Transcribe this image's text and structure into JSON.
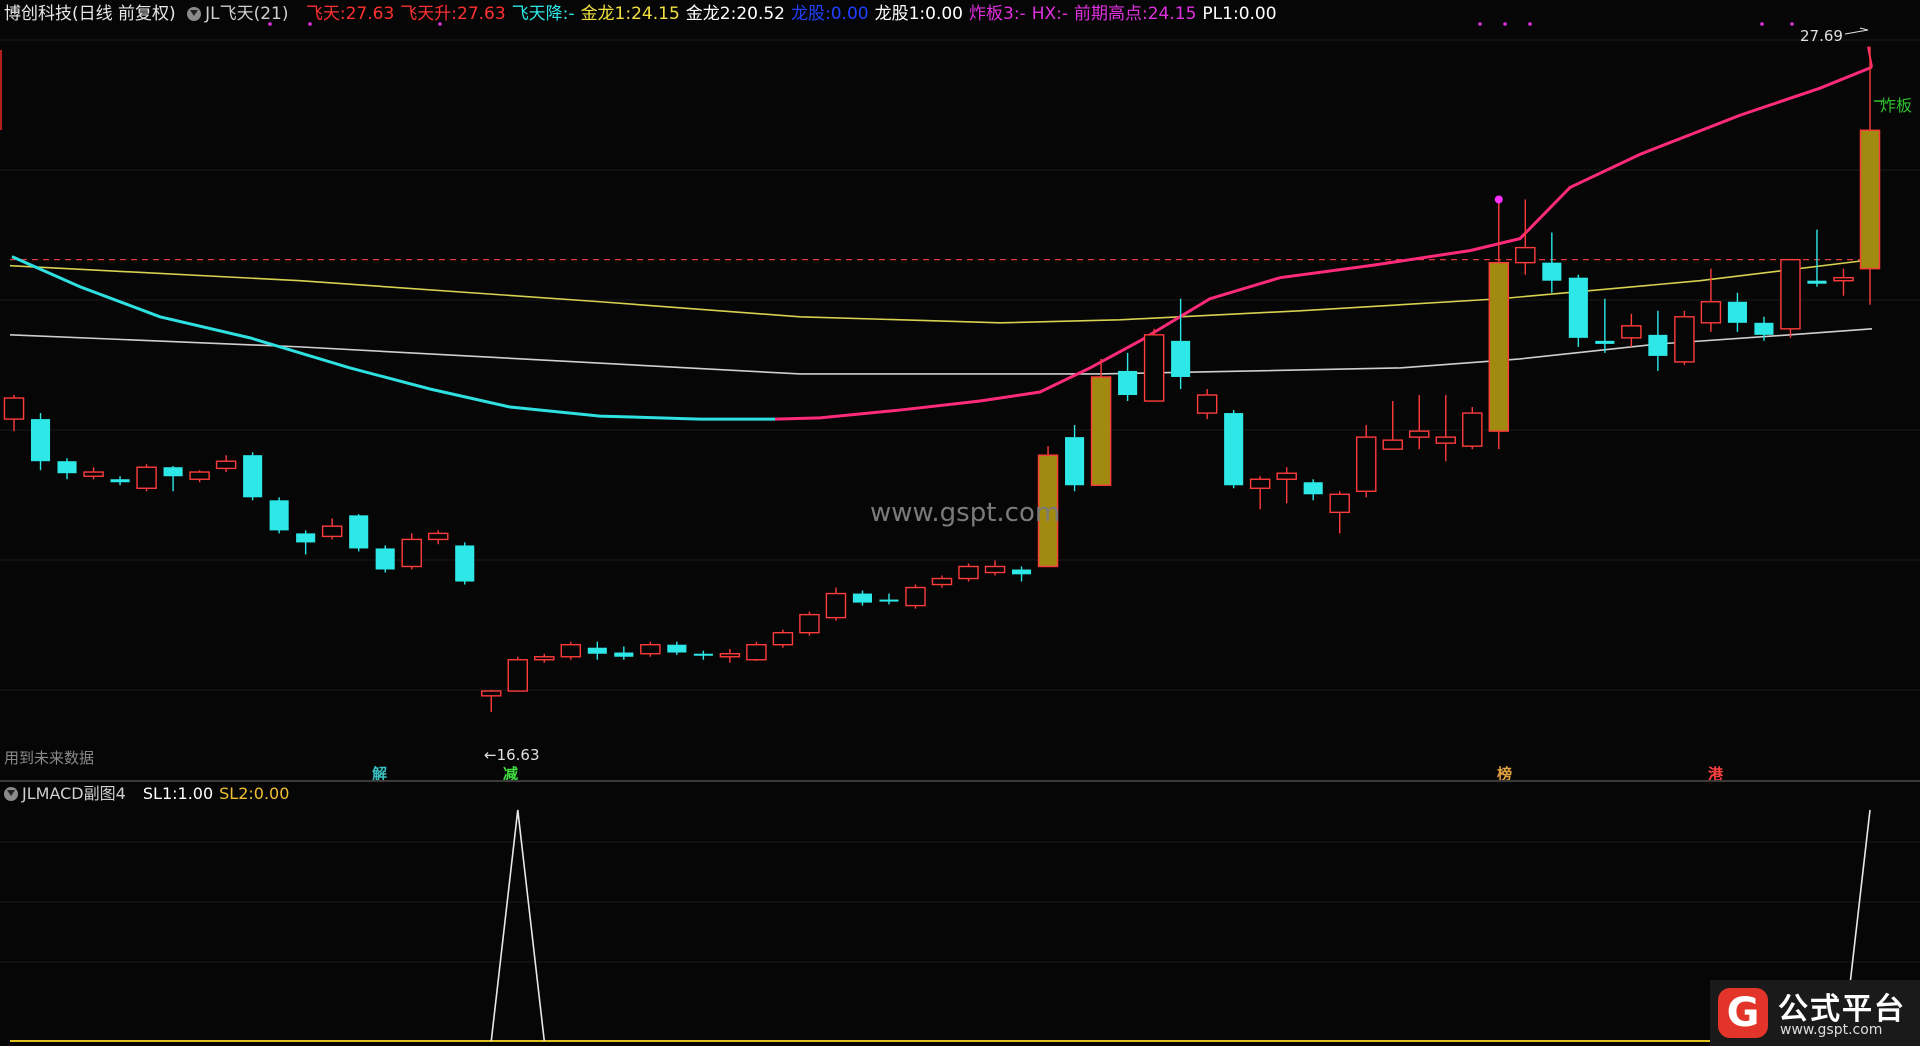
{
  "header": {
    "stock": "博创科技(日线 前复权)",
    "indicator": "JL飞天(21)",
    "items": [
      {
        "label": "飞天:",
        "value": "27.63",
        "color": "#ff3030"
      },
      {
        "label": "飞天升:",
        "value": "27.63",
        "color": "#ff3030"
      },
      {
        "label": "飞天降:",
        "value": "-",
        "color": "#2ee8e8"
      },
      {
        "label": "金龙1:",
        "value": "24.15",
        "color": "#f0e040"
      },
      {
        "label": "金龙2:",
        "value": "20.52",
        "color": "#ffffff"
      },
      {
        "label": "龙股:",
        "value": "0.00",
        "color": "#2040ff"
      },
      {
        "label": "龙股1:",
        "value": "0.00",
        "color": "#ffffff"
      },
      {
        "label": "炸板3:",
        "value": "-",
        "color": "#e030e0"
      },
      {
        "label": "HX:",
        "value": "-",
        "color": "#e030e0"
      },
      {
        "label": "前期高点:",
        "value": "24.15",
        "color": "#e030e0"
      },
      {
        "label": "PL1:",
        "value": "0.00",
        "color": "#ffffff"
      }
    ]
  },
  "main_chart": {
    "high_label": "27.69",
    "low_label": "16.63",
    "burst_label": "炸板",
    "future_data_note": "用到未来数据",
    "markers": [
      {
        "text": "解",
        "color": "#3ac0c0"
      },
      {
        "text": "减",
        "color": "#40e040"
      },
      {
        "text": "榜",
        "color": "#e0a040"
      },
      {
        "text": "港",
        "color": "#ff4040"
      }
    ],
    "watermark": "www.gspt.com",
    "colors": {
      "up": "#ff3b3b",
      "down": "#2ee8e8",
      "limit": "#a08a10",
      "pink": "#ff2a7a",
      "cyan": "#2ee0e0",
      "yellow": "#d8d050",
      "white": "#cfcfcf"
    }
  },
  "chart_data": {
    "type": "candlestick",
    "ylim": [
      16,
      28
    ],
    "candles": [
      [
        21.5,
        21.85,
        21.9,
        21.3
      ],
      [
        21.5,
        20.8,
        21.6,
        20.65
      ],
      [
        20.8,
        20.6,
        20.85,
        20.5
      ],
      [
        20.55,
        20.62,
        20.7,
        20.5
      ],
      [
        20.5,
        20.45,
        20.55,
        20.4
      ],
      [
        20.35,
        20.7,
        20.75,
        20.3
      ],
      [
        20.7,
        20.55,
        20.72,
        20.3
      ],
      [
        20.5,
        20.62,
        20.65,
        20.45
      ],
      [
        20.68,
        20.8,
        20.9,
        20.62
      ],
      [
        20.9,
        20.2,
        20.95,
        20.15
      ],
      [
        20.15,
        19.65,
        20.2,
        19.6
      ],
      [
        19.6,
        19.45,
        19.65,
        19.25
      ],
      [
        19.55,
        19.72,
        19.85,
        19.5
      ],
      [
        19.9,
        19.35,
        19.92,
        19.3
      ],
      [
        19.35,
        19.0,
        19.4,
        18.95
      ],
      [
        19.05,
        19.5,
        19.6,
        19.0
      ],
      [
        19.5,
        19.6,
        19.65,
        19.42
      ],
      [
        19.4,
        18.8,
        19.45,
        18.75
      ],
      [
        16.9,
        16.98,
        17.0,
        16.63
      ],
      [
        16.98,
        17.5,
        17.55,
        16.98
      ],
      [
        17.5,
        17.55,
        17.6,
        17.45
      ],
      [
        17.55,
        17.75,
        17.8,
        17.5
      ],
      [
        17.7,
        17.6,
        17.8,
        17.5
      ],
      [
        17.62,
        17.55,
        17.72,
        17.5
      ],
      [
        17.6,
        17.75,
        17.8,
        17.55
      ],
      [
        17.75,
        17.62,
        17.8,
        17.58
      ],
      [
        17.6,
        17.58,
        17.65,
        17.5
      ],
      [
        17.55,
        17.6,
        17.68,
        17.45
      ],
      [
        17.5,
        17.75,
        17.8,
        17.48
      ],
      [
        17.75,
        17.95,
        18.0,
        17.7
      ],
      [
        17.95,
        18.25,
        18.3,
        17.9
      ],
      [
        18.2,
        18.6,
        18.7,
        18.15
      ],
      [
        18.6,
        18.45,
        18.65,
        18.4
      ],
      [
        18.5,
        18.48,
        18.6,
        18.42
      ],
      [
        18.4,
        18.7,
        18.75,
        18.35
      ],
      [
        18.75,
        18.85,
        18.9,
        18.7
      ],
      [
        18.85,
        19.05,
        19.1,
        18.8
      ],
      [
        18.95,
        19.05,
        19.15,
        18.9
      ],
      [
        19.0,
        18.92,
        19.05,
        18.8
      ],
      [
        19.05,
        20.9,
        21.05,
        19.05
      ],
      [
        21.2,
        20.4,
        21.4,
        20.3
      ],
      [
        20.4,
        22.2,
        22.5,
        20.4
      ],
      [
        22.3,
        21.9,
        22.6,
        21.8
      ],
      [
        21.8,
        22.9,
        23.0,
        21.8
      ],
      [
        22.8,
        22.2,
        23.5,
        22.0
      ],
      [
        21.6,
        21.9,
        22.0,
        21.5
      ],
      [
        21.6,
        20.4,
        21.65,
        20.35
      ],
      [
        20.35,
        20.5,
        20.55,
        20.0
      ],
      [
        20.5,
        20.6,
        20.7,
        20.1
      ],
      [
        20.45,
        20.25,
        20.5,
        20.15
      ],
      [
        19.95,
        20.25,
        20.3,
        19.6
      ],
      [
        20.3,
        21.2,
        21.4,
        20.2
      ],
      [
        21.0,
        21.15,
        21.8,
        21.0
      ],
      [
        21.2,
        21.3,
        21.9,
        21.0
      ],
      [
        21.1,
        21.2,
        21.9,
        20.8
      ],
      [
        21.05,
        21.6,
        21.7,
        21.0
      ],
      [
        21.3,
        24.1,
        25.15,
        21.0
      ],
      [
        24.1,
        24.35,
        25.15,
        23.9
      ],
      [
        24.1,
        23.8,
        24.6,
        23.6
      ],
      [
        23.85,
        22.85,
        23.9,
        22.7
      ],
      [
        22.8,
        22.75,
        23.5,
        22.6
      ],
      [
        22.85,
        23.05,
        23.25,
        22.7
      ],
      [
        22.9,
        22.55,
        23.3,
        22.3
      ],
      [
        22.45,
        23.2,
        23.3,
        22.4
      ],
      [
        23.1,
        23.45,
        24.0,
        22.95
      ],
      [
        23.45,
        23.1,
        23.6,
        22.95
      ],
      [
        23.1,
        22.9,
        23.2,
        22.8
      ],
      [
        23.0,
        24.15,
        24.15,
        22.85
      ],
      [
        23.8,
        23.75,
        24.65,
        23.7
      ],
      [
        23.8,
        23.85,
        24.0,
        23.55
      ],
      [
        24.0,
        26.3,
        27.69,
        23.4
      ]
    ]
  },
  "sub_chart": {
    "indicator": "JLMACD副图4",
    "items": [
      {
        "label": "SL1:",
        "value": "1.00",
        "color": "#ffffff"
      },
      {
        "label": "SL2:",
        "value": "0.00",
        "color": "#f0c030"
      }
    ]
  },
  "logo": {
    "brand": "公式平台",
    "url": "www.gspt.com"
  }
}
